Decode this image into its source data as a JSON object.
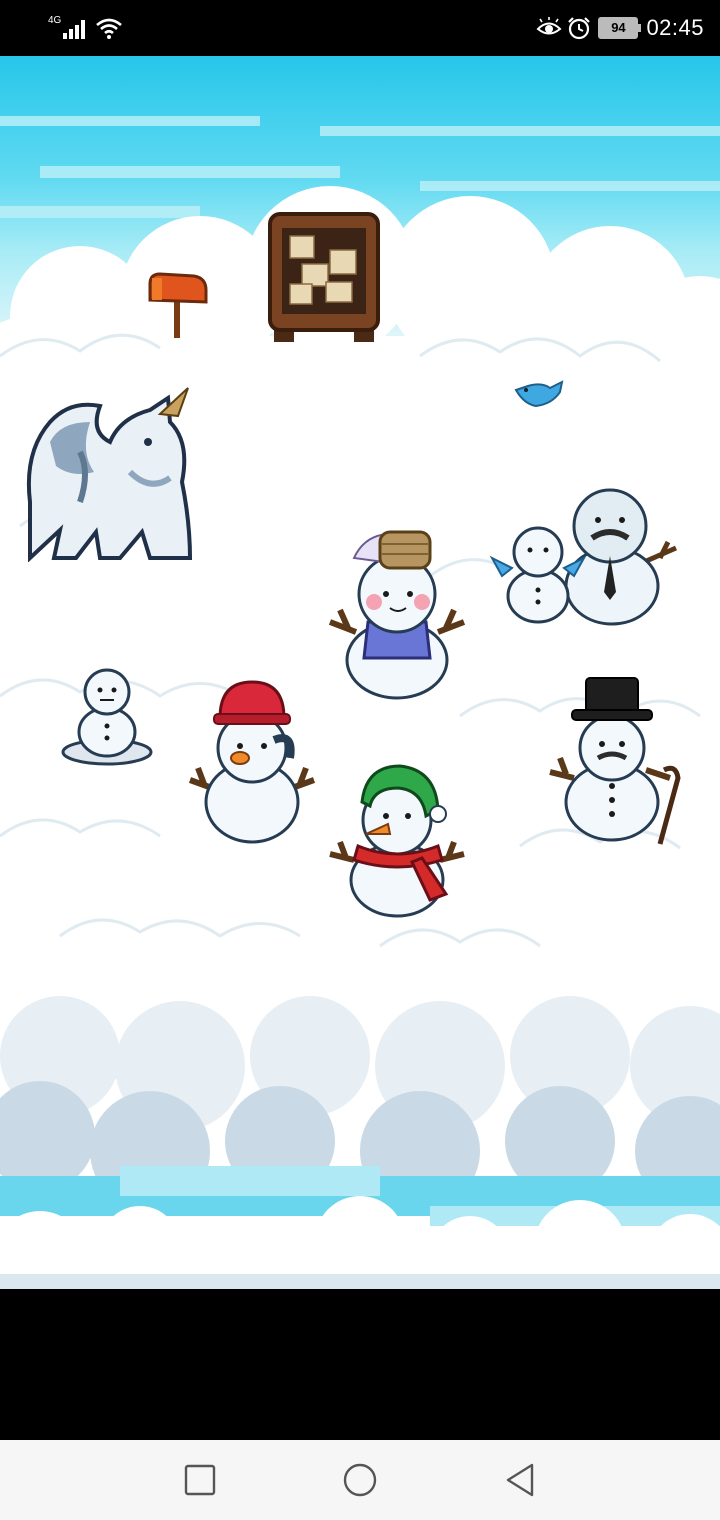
{
  "status_bar": {
    "network_label": "4G",
    "battery_level": "94",
    "time": "02:45",
    "icons": [
      "signal-icon",
      "wifi-icon",
      "eye-comfort-icon",
      "alarm-icon",
      "battery-icon"
    ]
  },
  "game": {
    "scene": "cloud-top-village",
    "objects": [
      "mailbox",
      "notice-board",
      "blue-bird",
      "ice-dragon-statue",
      "snowman-with-basket",
      "snowmen-father-and-son",
      "snowman-on-plate",
      "snowman-red-bucket-hat",
      "snowman-green-hat-scarf",
      "snowman-top-hat-cane"
    ],
    "colors": {
      "sky_top": "#27c6ea",
      "cloud": "#ffffff",
      "cloud_shadow": "#d7e6ef",
      "scarf_red": "#d42a2a",
      "hat_green": "#2fa84a",
      "bucket_red": "#d9283a"
    }
  },
  "nav_bar": {
    "icons": [
      "recent-apps-icon",
      "home-icon",
      "back-icon"
    ]
  }
}
